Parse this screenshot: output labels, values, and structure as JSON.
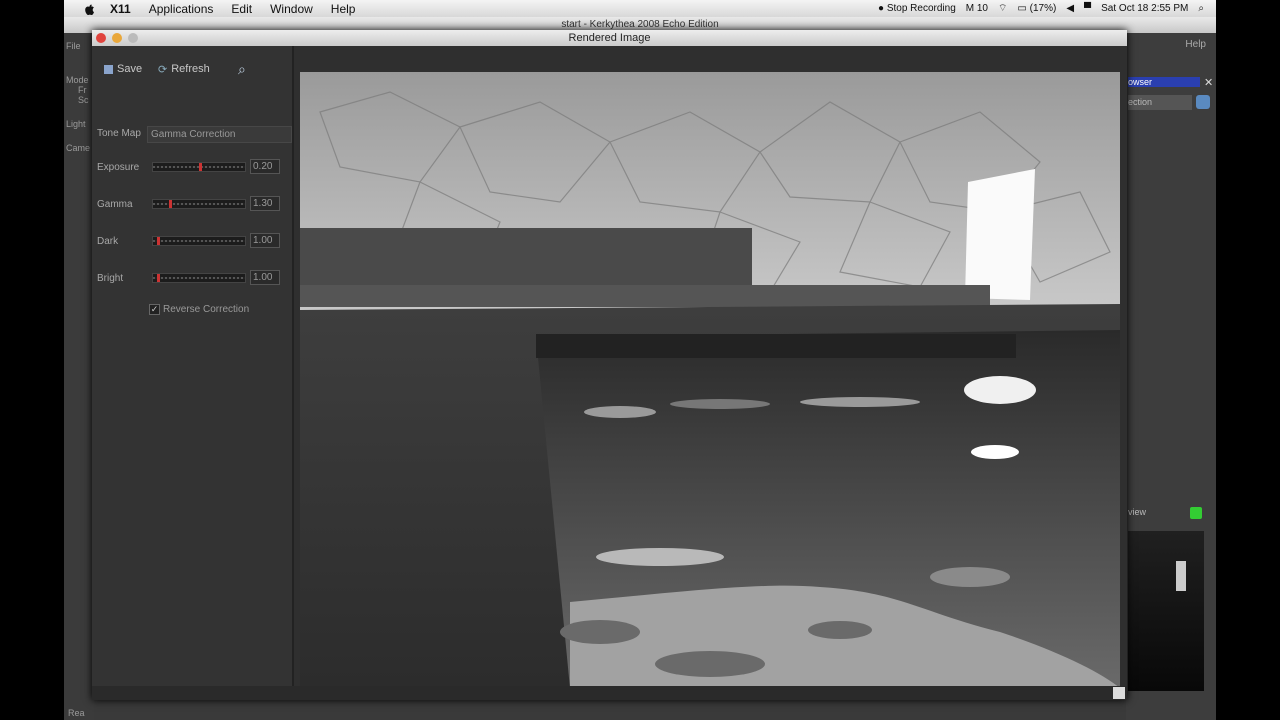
{
  "menubar": {
    "app": "X11",
    "menus": [
      "Applications",
      "Edit",
      "Window",
      "Help"
    ],
    "recording": "Stop Recording",
    "count": "10",
    "battery": "(17%)",
    "datetime": "Sat Oct 18  2:55 PM"
  },
  "bg_window": {
    "title": "start - Kerkythea 2008 Echo Edition",
    "left_items": [
      "File",
      "Mode",
      "Fr",
      "Sc",
      "Light",
      "Came"
    ],
    "right_items": [
      "Help",
      "owser",
      "ection",
      "view"
    ],
    "status_text": "Rea"
  },
  "render_window": {
    "title": "Rendered Image",
    "toolbar": {
      "save": "Save",
      "refresh": "Refresh"
    },
    "tone_map": {
      "label": "Tone Map",
      "value": "Gamma Correction"
    },
    "params": [
      {
        "label": "Exposure",
        "value": "0.20",
        "level": 0.52
      },
      {
        "label": "Gamma",
        "value": "1.30",
        "level": 0.18
      },
      {
        "label": "Dark",
        "value": "1.00",
        "level": 0.05
      },
      {
        "label": "Bright",
        "value": "1.00",
        "level": 0.05
      }
    ],
    "reverse_correction": {
      "label": "Reverse Correction",
      "checked": true
    }
  }
}
